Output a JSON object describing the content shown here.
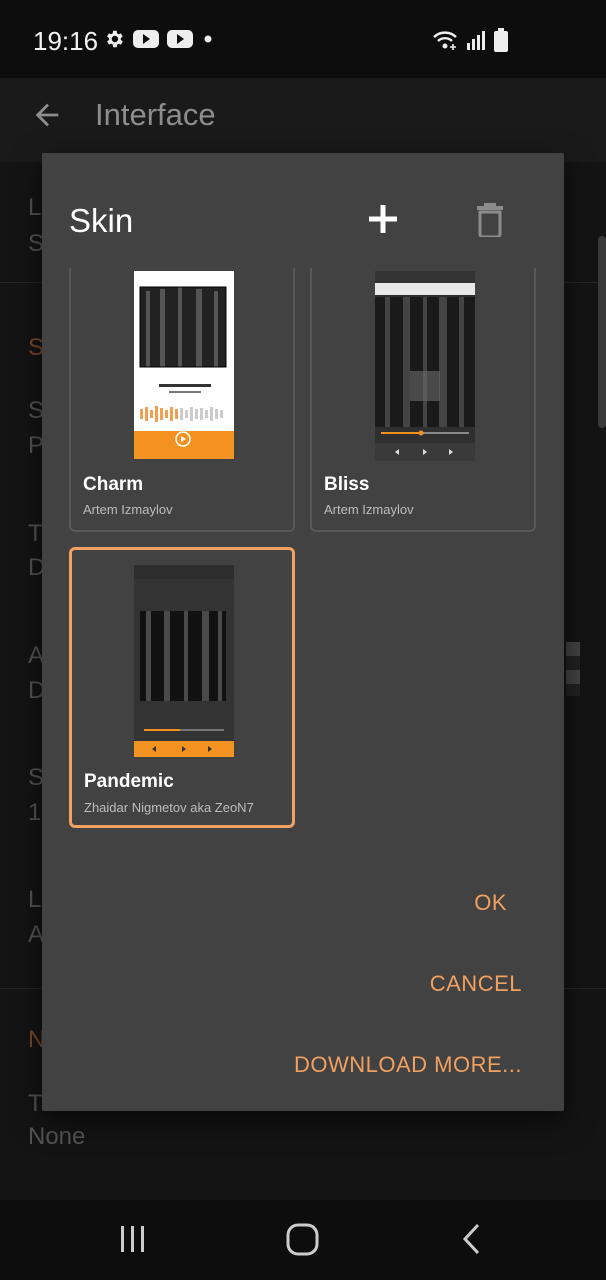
{
  "status_bar": {
    "time": "19:16",
    "icons": [
      "gear-icon",
      "youtube-icon",
      "youtube-icon",
      "dot-icon"
    ],
    "right_icons": [
      "wifi-icon",
      "signal-icon",
      "battery-icon"
    ]
  },
  "app_bar": {
    "title": "Interface",
    "back_icon": "arrow-left-icon"
  },
  "background_list": {
    "items": [
      {
        "title": "L",
        "subtitle": "S"
      },
      {
        "title": "S",
        "subtitle": "",
        "section": true
      },
      {
        "title": "S",
        "subtitle": "P"
      },
      {
        "title": "T",
        "subtitle": "D"
      },
      {
        "title": "A",
        "subtitle": "D"
      },
      {
        "title": "S",
        "subtitle": "1"
      },
      {
        "title": "L",
        "subtitle": "A"
      },
      {
        "title": "N",
        "subtitle": "",
        "section": true
      },
      {
        "title": "T",
        "subtitle": "None"
      }
    ]
  },
  "dialog": {
    "title": "Skin",
    "add_icon": "plus-icon",
    "delete_icon": "trash-icon",
    "skins": [
      {
        "name": "Charm",
        "author": "Artem Izmaylov",
        "selected": false
      },
      {
        "name": "Bliss",
        "author": "Artem Izmaylov",
        "selected": false
      },
      {
        "name": "Pandemic",
        "author": "Zhaidar Nigmetov aka ZeoN7",
        "selected": true
      }
    ],
    "buttons": {
      "ok": "OK",
      "cancel": "CANCEL",
      "download": "DOWNLOAD MORE..."
    },
    "accent_color": "#f0a060"
  },
  "nav_bar": {
    "icons": [
      "recents-icon",
      "home-icon",
      "back-icon"
    ]
  }
}
